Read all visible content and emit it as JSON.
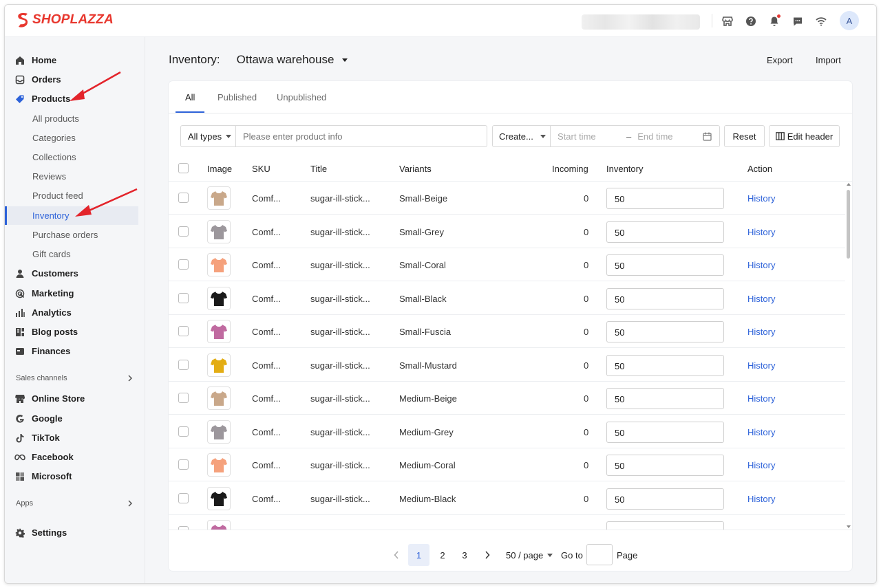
{
  "brand": {
    "name": "SHOPLAZZA",
    "color": "#e8372e"
  },
  "topbar": {
    "icons": [
      "store-icon",
      "help-icon",
      "bell-icon",
      "chat-icon",
      "wifi-icon"
    ],
    "avatar_initial": "A"
  },
  "sidebar": {
    "items": [
      {
        "label": "Home",
        "icon": "home-icon"
      },
      {
        "label": "Orders",
        "icon": "orders-icon"
      },
      {
        "label": "Products",
        "icon": "tag-icon"
      }
    ],
    "product_subitems": [
      "All products",
      "Categories",
      "Collections",
      "Reviews",
      "Product feed",
      "Inventory",
      "Purchase orders",
      "Gift cards"
    ],
    "active_subitem": "Inventory",
    "items2": [
      {
        "label": "Customers",
        "icon": "person-icon"
      },
      {
        "label": "Marketing",
        "icon": "target-icon"
      },
      {
        "label": "Analytics",
        "icon": "bar-chart-icon"
      },
      {
        "label": "Blog posts",
        "icon": "blog-icon"
      },
      {
        "label": "Finances",
        "icon": "finance-icon"
      }
    ],
    "sales_channels_label": "Sales channels",
    "channels": [
      {
        "label": "Online Store",
        "icon": "store-icon"
      },
      {
        "label": "Google",
        "icon": "google-icon"
      },
      {
        "label": "TikTok",
        "icon": "tiktok-icon"
      },
      {
        "label": "Facebook",
        "icon": "meta-icon"
      },
      {
        "label": "Microsoft",
        "icon": "microsoft-icon"
      }
    ],
    "apps_label": "Apps",
    "settings_label": "Settings"
  },
  "header": {
    "title": "Inventory:",
    "warehouse": "Ottawa warehouse",
    "export_label": "Export",
    "import_label": "Import"
  },
  "tabs": [
    "All",
    "Published",
    "Unpublished"
  ],
  "filters": {
    "type_select": "All types",
    "search_placeholder": "Please enter product info",
    "date_select": "Create...",
    "start_placeholder": "Start time",
    "range_separator": "–",
    "end_placeholder": "End time",
    "reset_label": "Reset",
    "edit_header_label": "Edit header"
  },
  "table": {
    "columns": [
      "Image",
      "SKU",
      "Title",
      "Variants",
      "Incoming",
      "Inventory",
      "Action"
    ],
    "rows": [
      {
        "sku": "Comf...",
        "title": "sugar-ill-stick...",
        "variant": "Small-Beige",
        "incoming": "0",
        "inventory": "50",
        "action": "History",
        "color": "#c9a88a"
      },
      {
        "sku": "Comf...",
        "title": "sugar-ill-stick...",
        "variant": "Small-Grey",
        "incoming": "0",
        "inventory": "50",
        "action": "History",
        "color": "#9c979c"
      },
      {
        "sku": "Comf...",
        "title": "sugar-ill-stick...",
        "variant": "Small-Coral",
        "incoming": "0",
        "inventory": "50",
        "action": "History",
        "color": "#f5a17c"
      },
      {
        "sku": "Comf...",
        "title": "sugar-ill-stick...",
        "variant": "Small-Black",
        "incoming": "0",
        "inventory": "50",
        "action": "History",
        "color": "#1a1a1a"
      },
      {
        "sku": "Comf...",
        "title": "sugar-ill-stick...",
        "variant": "Small-Fuscia",
        "incoming": "0",
        "inventory": "50",
        "action": "History",
        "color": "#c06aa0"
      },
      {
        "sku": "Comf...",
        "title": "sugar-ill-stick...",
        "variant": "Small-Mustard",
        "incoming": "0",
        "inventory": "50",
        "action": "History",
        "color": "#e3ad14"
      },
      {
        "sku": "Comf...",
        "title": "sugar-ill-stick...",
        "variant": "Medium-Beige",
        "incoming": "0",
        "inventory": "50",
        "action": "History",
        "color": "#c9a88a"
      },
      {
        "sku": "Comf...",
        "title": "sugar-ill-stick...",
        "variant": "Medium-Grey",
        "incoming": "0",
        "inventory": "50",
        "action": "History",
        "color": "#9c979c"
      },
      {
        "sku": "Comf...",
        "title": "sugar-ill-stick...",
        "variant": "Medium-Coral",
        "incoming": "0",
        "inventory": "50",
        "action": "History",
        "color": "#f5a17c"
      },
      {
        "sku": "Comf...",
        "title": "sugar-ill-stick...",
        "variant": "Medium-Black",
        "incoming": "0",
        "inventory": "50",
        "action": "History",
        "color": "#1a1a1a"
      },
      {
        "sku": "",
        "title": "",
        "variant": "",
        "incoming": "",
        "inventory": "",
        "action": "",
        "color": "#c06aa0"
      }
    ]
  },
  "pagination": {
    "pages": [
      "1",
      "2",
      "3"
    ],
    "current": "1",
    "page_size": "50 / page",
    "goto_label": "Go to",
    "page_label": "Page"
  },
  "colors": {
    "accent": "#2d62d9",
    "annotation": "#e3242b"
  }
}
